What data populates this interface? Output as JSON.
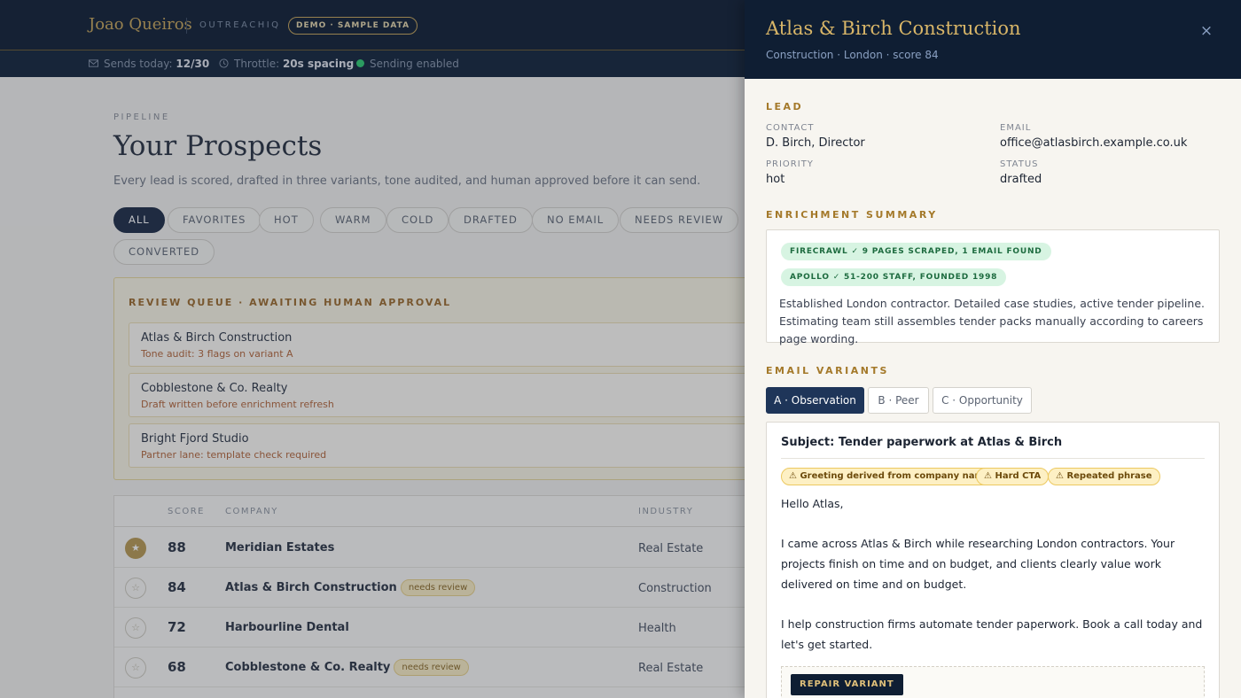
{
  "header": {
    "brand": "Joao Queiros",
    "app_name": "OUTREACHIQ",
    "badge": "DEMO · SAMPLE DATA"
  },
  "statusbar": {
    "sends_label": "Sends today:",
    "sends_value": "12/30",
    "throttle_label": "Throttle:",
    "throttle_value": "20s spacing",
    "sending_status": "Sending enabled"
  },
  "page": {
    "eyebrow": "PIPELINE",
    "title": "Your Prospects",
    "subtitle": "Every lead is scored, drafted in three variants, tone audited, and human approved before it can send."
  },
  "filters": [
    "ALL",
    "FAVORITES",
    "HOT",
    "WARM",
    "COLD",
    "DRAFTED",
    "NO EMAIL",
    "NEEDS REVIEW",
    "CONVERTED"
  ],
  "active_filter": "ALL",
  "review_queue": {
    "title": "REVIEW QUEUE · AWAITING HUMAN APPROVAL",
    "items": [
      {
        "name": "Atlas & Birch Construction",
        "note": "Tone audit: 3 flags on variant A"
      },
      {
        "name": "Cobblestone & Co. Realty",
        "note": "Draft written before enrichment refresh"
      },
      {
        "name": "Bright Fjord Studio",
        "note": "Partner lane: template check required"
      }
    ]
  },
  "table": {
    "headers": {
      "score": "SCORE",
      "company": "COMPANY",
      "industry": "INDUSTRY"
    },
    "rows": [
      {
        "favorite": true,
        "score": "88",
        "company": "Meridian Estates",
        "badge": "",
        "industry": "Real Estate"
      },
      {
        "favorite": false,
        "score": "84",
        "company": "Atlas & Birch Construction",
        "badge": "needs review",
        "industry": "Construction"
      },
      {
        "favorite": false,
        "score": "72",
        "company": "Harbourline Dental",
        "badge": "",
        "industry": "Health"
      },
      {
        "favorite": false,
        "score": "68",
        "company": "Cobblestone & Co. Realty",
        "badge": "needs review",
        "industry": "Real Estate"
      }
    ]
  },
  "drawer": {
    "title": "Atlas & Birch Construction",
    "subtitle": "Construction · London · score 84",
    "close_icon": "×",
    "lead": {
      "section": "LEAD",
      "contact_label": "CONTACT",
      "contact": "D. Birch, Director",
      "email_label": "EMAIL",
      "email": "office@atlasbirch.example.co.uk",
      "priority_label": "PRIORITY",
      "priority": "hot",
      "status_label": "STATUS",
      "status": "drafted"
    },
    "enrichment": {
      "section": "ENRICHMENT SUMMARY",
      "tags": [
        "FIRECRAWL ✓ 9 PAGES SCRAPED, 1 EMAIL FOUND",
        "APOLLO ✓ 51-200 STAFF, FOUNDED 1998"
      ],
      "summary": "Established London contractor. Detailed case studies, active tender pipeline. Estimating team still assembles tender packs manually according to careers page wording."
    },
    "variants": {
      "section": "EMAIL VARIANTS",
      "tabs": [
        "A · Observation",
        "B · Peer",
        "C · Opportunity"
      ],
      "active_tab": "A · Observation",
      "subject": "Subject: Tender paperwork at Atlas & Birch",
      "flags": [
        "⚠ Greeting derived from company name",
        "⚠ Hard CTA",
        "⚠ Repeated phrase"
      ],
      "greeting": "Hello Atlas,",
      "paragraph_1": "I came across Atlas & Birch while researching London contractors. Your projects finish on time and on budget, and clients clearly value work delivered on time and on budget.",
      "paragraph_2": "I help construction firms automate tender paperwork. Book a call today and let's get started.",
      "repair_button": "REPAIR VARIANT"
    }
  },
  "colors": {
    "navy": "#0f1e33",
    "gold": "#c9a659",
    "active_tab": "#1e3559",
    "flag_bg": "#fdf0c4",
    "enrich_tag_bg": "#d7f4e2"
  }
}
